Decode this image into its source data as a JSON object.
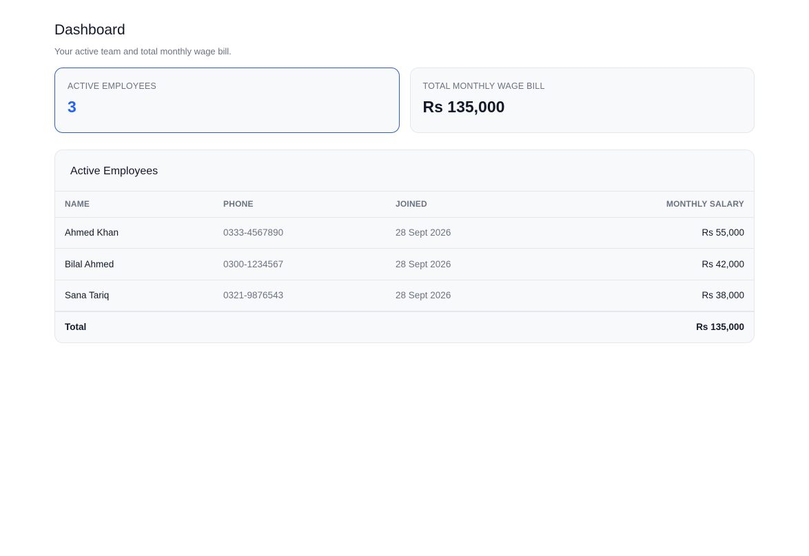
{
  "header": {
    "title": "Dashboard",
    "subtitle": "Your active team and total monthly wage bill."
  },
  "stats": {
    "active_employees": {
      "label": "Active Employees",
      "value": "3"
    },
    "wage_bill": {
      "label": "Total Monthly Wage Bill",
      "value": "Rs 135,000"
    }
  },
  "table": {
    "title": "Active Employees",
    "columns": [
      "Name",
      "Phone",
      "Joined",
      "Monthly Salary"
    ],
    "rows": [
      {
        "name": "Ahmed Khan",
        "phone": "0333-4567890",
        "joined": "28 Sept 2026",
        "salary": "Rs 55,000"
      },
      {
        "name": "Bilal Ahmed",
        "phone": "0300-1234567",
        "joined": "28 Sept 2026",
        "salary": "Rs 42,000"
      },
      {
        "name": "Sana Tariq",
        "phone": "0321-9876543",
        "joined": "28 Sept 2026",
        "salary": "Rs 38,000"
      }
    ],
    "footer": {
      "label": "Total",
      "value": "Rs 135,000"
    }
  },
  "colors": {
    "accent": "#2563eb",
    "active_border": "#2f5fb8",
    "card_bg": "#f8f9fb",
    "border": "#e5e7eb",
    "muted_text": "#6b7280"
  }
}
